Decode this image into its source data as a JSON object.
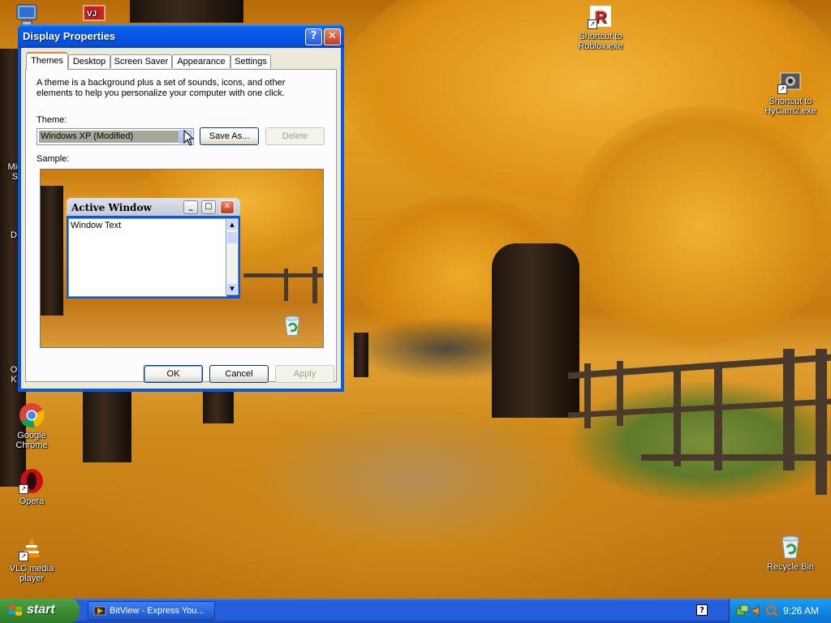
{
  "desktop_icons": [
    {
      "name": "my-computer-icon",
      "label": "My"
    },
    {
      "name": "micro-icon",
      "label": "Micro\nStu"
    },
    {
      "name": "d-icon",
      "label": "D"
    },
    {
      "name": "ok-icon",
      "label": "O\nK"
    },
    {
      "name": "chrome-icon",
      "label": "Google Chrome"
    },
    {
      "name": "opera-icon",
      "label": "Opera"
    },
    {
      "name": "vlc-icon",
      "label": "VLC media\nplayer"
    },
    {
      "name": "roblox-icon",
      "label": "Shortcut to\nRoblox.exe"
    },
    {
      "name": "hycam-icon",
      "label": "Shortcut to\nHyCam2.exe"
    },
    {
      "name": "recycle-bin-icon",
      "label": "Recycle Bin"
    }
  ],
  "dialog": {
    "title": "Display Properties",
    "help_glyph": "?",
    "close_glyph": "✕",
    "tabs": [
      {
        "label": "Themes",
        "active": true
      },
      {
        "label": "Desktop",
        "active": false
      },
      {
        "label": "Screen Saver",
        "active": false
      },
      {
        "label": "Appearance",
        "active": false
      },
      {
        "label": "Settings",
        "active": false
      }
    ],
    "description": "A theme is a background plus a set of sounds, icons, and other elements to help you personalize your computer with one click.",
    "theme_label": "Theme:",
    "theme_value": "Windows XP (Modified)",
    "save_as_label": "Save As...",
    "delete_label": "Delete",
    "sample_label": "Sample:",
    "sample_window_title": "Active Window",
    "sample_window_text": "Window Text",
    "ok_label": "OK",
    "cancel_label": "Cancel",
    "apply_label": "Apply"
  },
  "taskbar": {
    "start_label": "start",
    "task_label": "BitView - Express You...",
    "clock": "9:26 AM"
  },
  "colors": {
    "xp_blue": "#0b57e0",
    "dialog_face": "#ece9d8",
    "start_green": "#3c8f36",
    "active_tab_accent": "#e68b2c"
  }
}
